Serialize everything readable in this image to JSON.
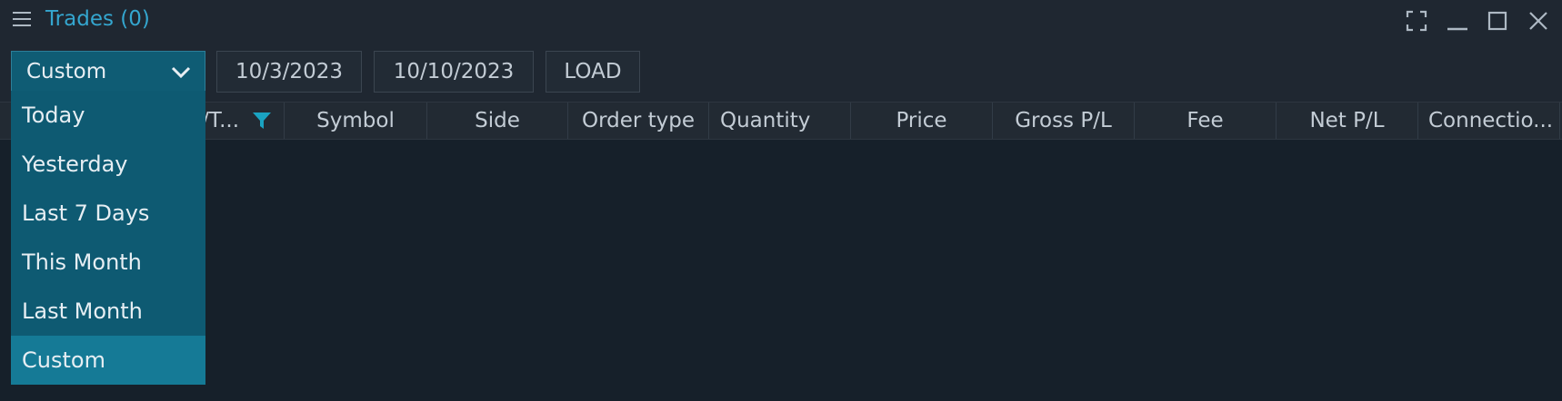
{
  "window": {
    "title": "Trades (0)",
    "icons": [
      "menu-icon",
      "fullscreen-icon",
      "minimize-icon",
      "maximize-icon",
      "close-icon"
    ]
  },
  "toolbar": {
    "period_select": "Custom",
    "from_date": "10/3/2023",
    "to_date": "10/10/2023",
    "load_label": "LOAD"
  },
  "grid": {
    "columns": [
      {
        "label": "/T..."
      },
      {
        "label": "Symbol"
      },
      {
        "label": "Side"
      },
      {
        "label": "Order type"
      },
      {
        "label": "Quantity"
      },
      {
        "label": "Price"
      },
      {
        "label": "Gross P/L"
      },
      {
        "label": "Fee"
      },
      {
        "label": "Net P/L"
      },
      {
        "label": "Connectio..."
      }
    ]
  },
  "dropdown": {
    "options": [
      "Today",
      "Yesterday",
      "Last 7 Days",
      "This Month",
      "Last Month",
      "Custom"
    ],
    "selected": "Custom"
  },
  "colors": {
    "accent": "#34a6cf",
    "dropdown_bg": "#0e5a72",
    "dropdown_selected": "#157a96",
    "filter_icon": "#1aa3c2"
  }
}
